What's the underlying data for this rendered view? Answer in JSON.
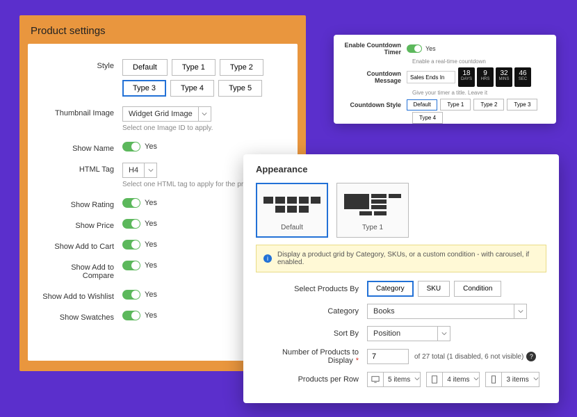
{
  "product_settings": {
    "title": "Product settings",
    "style": {
      "label": "Style",
      "options": [
        "Default",
        "Type 1",
        "Type 2",
        "Type 3",
        "Type 4",
        "Type 5"
      ],
      "selected": "Type 3",
      "o0": "Default",
      "o1": "Type 1",
      "o2": "Type 2",
      "o3": "Type 3",
      "o4": "Type 4",
      "o5": "Type 5"
    },
    "thumbnail": {
      "label": "Thumbnail Image",
      "value": "Widget Grid Image",
      "help": "Select one Image ID to apply."
    },
    "show_name": {
      "label": "Show Name",
      "value": "Yes"
    },
    "html_tag": {
      "label": "HTML Tag",
      "value": "H4",
      "help": "Select one HTML tag to apply for the product name."
    },
    "show_rating": {
      "label": "Show Rating",
      "value": "Yes"
    },
    "show_price": {
      "label": "Show Price",
      "value": "Yes"
    },
    "show_cart": {
      "label": "Show Add to Cart",
      "value": "Yes"
    },
    "show_compare": {
      "label": "Show Add to Compare",
      "value": "Yes"
    },
    "show_wishlist": {
      "label": "Show Add to Wishlist",
      "value": "Yes"
    },
    "show_swatches": {
      "label": "Show Swatches",
      "value": "Yes"
    }
  },
  "countdown": {
    "enable": {
      "label": "Enable Countdown Timer",
      "value": "Yes",
      "help": "Enable a real-time countdown"
    },
    "message": {
      "label": "Countdown Message",
      "value": "Sales Ends In",
      "help": "Give your timer a title. Leave it"
    },
    "timer": {
      "days": "18",
      "hrs": "9",
      "mins": "32",
      "sec": "46",
      "ld": "DAYS",
      "lh": "HRS",
      "lm": "MINS",
      "ls": "SEC"
    },
    "style": {
      "label": "Countdown Style",
      "o0": "Default",
      "o1": "Type 1",
      "o2": "Type 2",
      "o3": "Type 3",
      "o4": "Type 4",
      "selected": "Default"
    }
  },
  "appearance": {
    "title": "Appearance",
    "tiles": {
      "t0": "Default",
      "t1": "Type 1"
    },
    "info": "Display a product grid by Category, SKUs, or a custom condition - with carousel, if enabled.",
    "select_by": {
      "label": "Select Products By",
      "o0": "Category",
      "o1": "SKU",
      "o2": "Condition"
    },
    "category": {
      "label": "Category",
      "value": "Books"
    },
    "sort_by": {
      "label": "Sort By",
      "value": "Position"
    },
    "num_products": {
      "label": "Number of Products to Display",
      "value": "7",
      "hint": "of 27 total (1 disabled, 6 not visible)"
    },
    "per_row": {
      "label": "Products per Row",
      "desktop": "5 items",
      "tablet": "4 items",
      "mobile": "3 items"
    }
  }
}
